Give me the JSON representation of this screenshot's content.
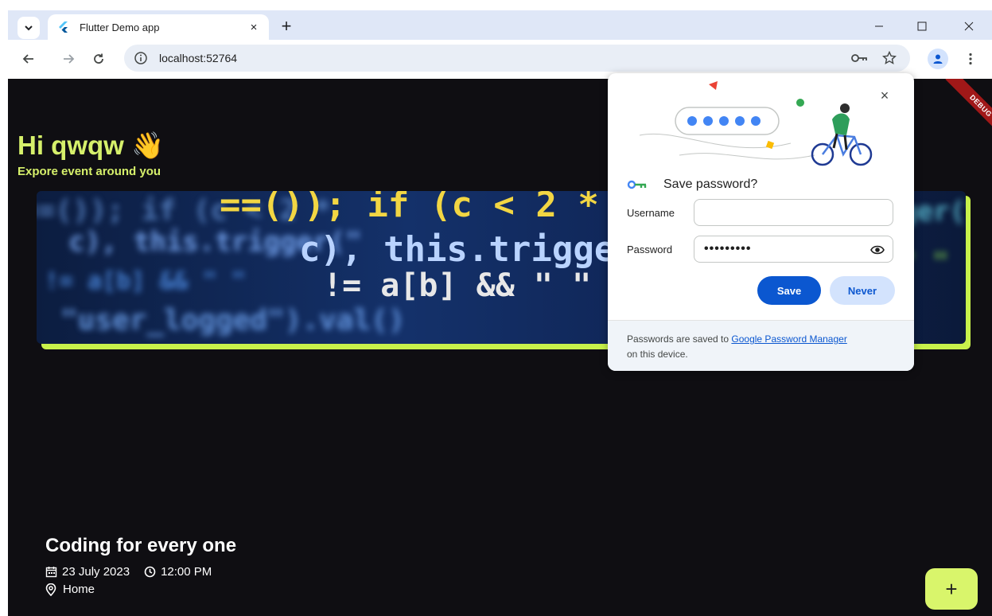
{
  "browser": {
    "tab_title": "Flutter Demo app",
    "tab_close": "×",
    "new_tab": "+",
    "url": "localhost:52764"
  },
  "app": {
    "greeting": "Hi qwqw 👋",
    "subtitle": "Expore event around you",
    "banner_code": {
      "line1": "==()); if (c < 2 *",
      "line2": "c), this.trigger(\"",
      "line3": "!= a[b] && \" \"",
      "line4": "\"user_logged\").val()"
    },
    "event": {
      "title": "Coding for every one",
      "date": "23 July 2023",
      "time": "12:00 PM",
      "location": "Home"
    },
    "fab_label": "+",
    "debug_banner": "DEBUG"
  },
  "password_popup": {
    "title": "Save password?",
    "username_label": "Username",
    "username_value": "",
    "password_label": "Password",
    "password_value": "•••••••••",
    "save_label": "Save",
    "never_label": "Never",
    "footer_prefix": "Passwords are saved to ",
    "footer_link": "Google Password Manager",
    "footer_suffix": "on this device.",
    "close": "×"
  },
  "colors": {
    "accent": "#d6f06b",
    "page_bg": "#0f0e12",
    "primary_button": "#0b57d0"
  }
}
